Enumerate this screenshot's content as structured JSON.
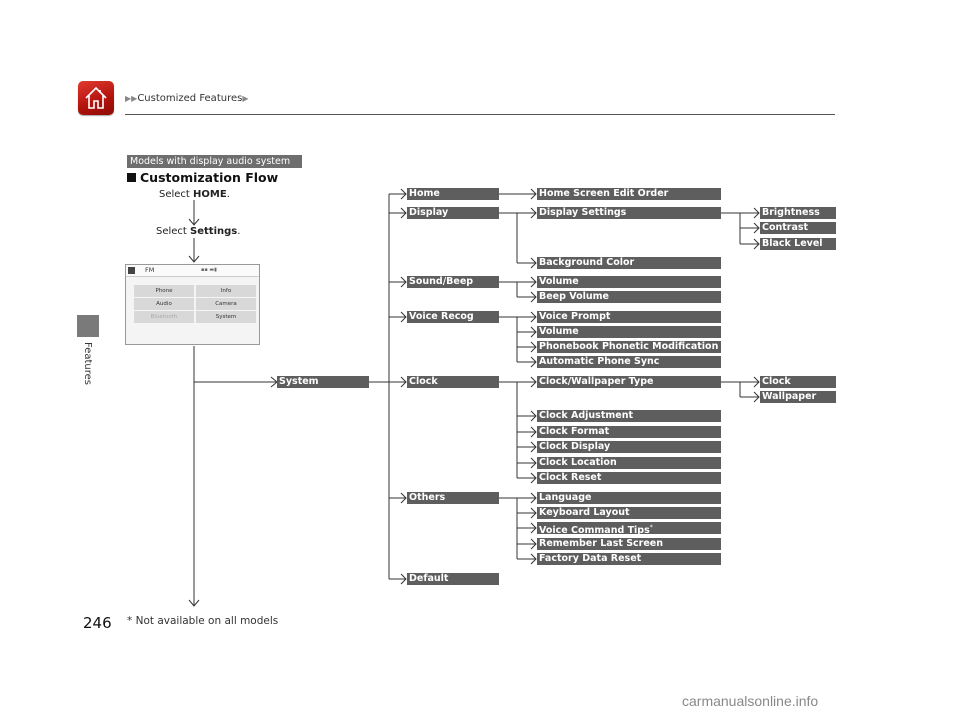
{
  "header": {
    "breadcrumb": "Customized Features",
    "home_icon": "home-icon"
  },
  "sidebar": {
    "section_label": "Features"
  },
  "page": {
    "number": "246",
    "footnote": "* Not available on all models",
    "watermark": "carmanualsonline.info"
  },
  "content": {
    "badge": "Models with display audio system",
    "title": "Customization Flow",
    "steps": [
      {
        "prefix": "Select ",
        "bold": "HOME",
        "suffix": "."
      },
      {
        "prefix": "Select ",
        "bold": "Settings",
        "suffix": "."
      }
    ],
    "screen": {
      "status": {
        "source": "FM"
      },
      "buttons": [
        {
          "label": "Phone",
          "enabled": true
        },
        {
          "label": "Info",
          "enabled": true
        },
        {
          "label": "Audio",
          "enabled": true
        },
        {
          "label": "Camera",
          "enabled": true
        },
        {
          "label": "Bluetooth",
          "enabled": false
        },
        {
          "label": "System",
          "enabled": true
        }
      ]
    }
  },
  "flow": {
    "root": "System",
    "level1": [
      "Home",
      "Display",
      "Sound/Beep",
      "Voice Recog",
      "Clock",
      "Others",
      "Default"
    ],
    "level2": {
      "home": [
        "Home Screen Edit Order"
      ],
      "display": [
        "Display Settings",
        "Background Color"
      ],
      "sound": [
        "Volume",
        "Beep Volume"
      ],
      "voice": [
        "Voice Prompt",
        "Volume",
        "Phonebook Phonetic Modification",
        "Automatic Phone Sync"
      ],
      "clock": [
        "Clock/Wallpaper Type",
        "Clock Adjustment",
        "Clock Format",
        "Clock Display",
        "Clock Location",
        "Clock Reset"
      ],
      "others": [
        "Language",
        "Keyboard Layout",
        "Voice Command Tips",
        "Remember Last Screen",
        "Factory Data Reset"
      ]
    },
    "footnote_marker": "*",
    "level3": {
      "display_settings": [
        "Brightness",
        "Contrast",
        "Black Level"
      ],
      "clock_wallpaper": [
        "Clock",
        "Wallpaper"
      ]
    }
  }
}
